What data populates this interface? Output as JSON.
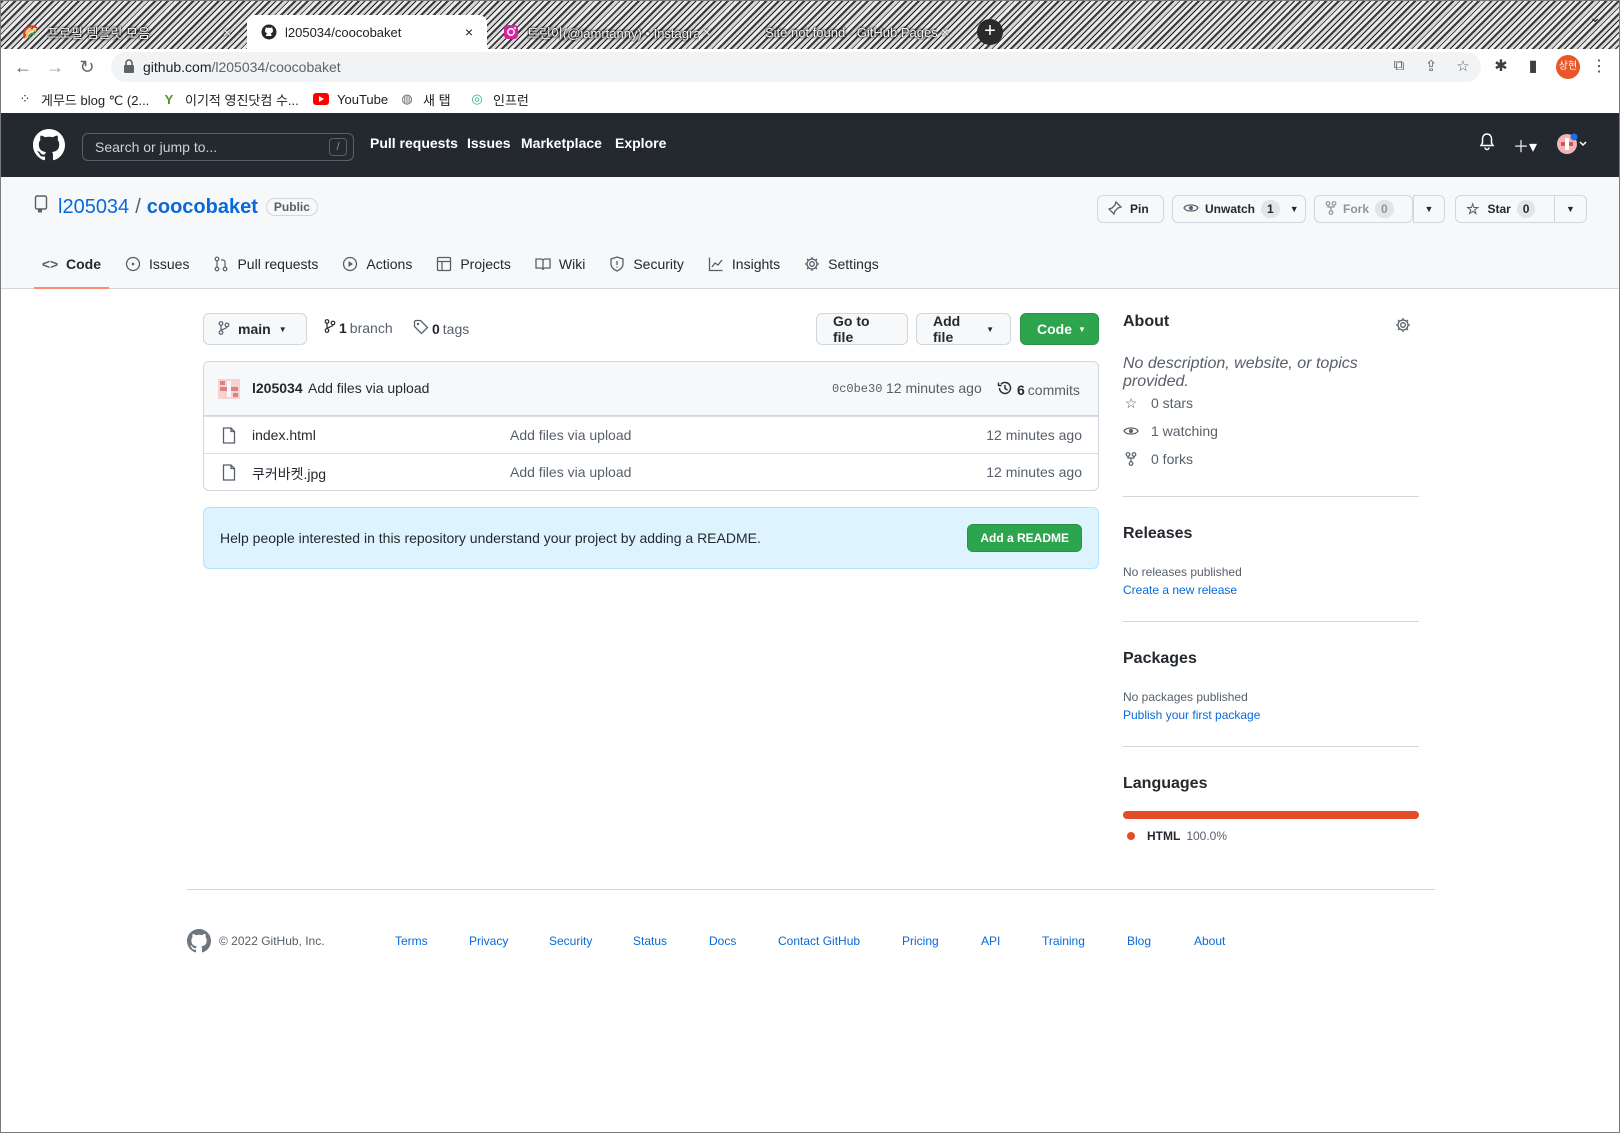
{
  "browser": {
    "tabs": [
      {
        "title": "프로필 템플릿 모음",
        "icon": "rainbow-icon"
      },
      {
        "title": "l205034/coocobaket",
        "icon": "github-icon"
      },
      {
        "title": "트린이(@iamrtanny) • Instagram",
        "icon": "instagram-icon"
      },
      {
        "title": "Site not found · GitHub Pages",
        "icon": "none"
      }
    ],
    "new_tab": "+",
    "url_host": "github.com",
    "url_path": "/l205034/coocobaket",
    "profile_label": "상현",
    "bookmarks": [
      {
        "label": "게무드 blog ℃ (2...",
        "icon": "dots-icon"
      },
      {
        "label": "이기적 영진닷컴 수...",
        "icon": "y-icon"
      },
      {
        "label": "YouTube",
        "icon": "youtube-icon"
      },
      {
        "label": "새 탭",
        "icon": "globe-icon"
      },
      {
        "label": "인프런",
        "icon": "inflearn-icon"
      }
    ]
  },
  "gh_header": {
    "search_placeholder": "Search or jump to...",
    "search_key": "/",
    "nav": [
      "Pull requests",
      "Issues",
      "Marketplace",
      "Explore"
    ]
  },
  "repo": {
    "owner": "l205034",
    "separator": "/",
    "name": "coocobaket",
    "visibility": "Public",
    "pin_label": "Pin",
    "watch_label": "Unwatch",
    "watch_count": "1",
    "fork_label": "Fork",
    "fork_count": "0",
    "star_label": "Star",
    "star_count": "0",
    "tabs": [
      {
        "label": "Code",
        "icon": "code-icon"
      },
      {
        "label": "Issues",
        "icon": "issue-icon"
      },
      {
        "label": "Pull requests",
        "icon": "pull-request-icon"
      },
      {
        "label": "Actions",
        "icon": "play-icon"
      },
      {
        "label": "Projects",
        "icon": "table-icon"
      },
      {
        "label": "Wiki",
        "icon": "book-icon"
      },
      {
        "label": "Security",
        "icon": "shield-icon"
      },
      {
        "label": "Insights",
        "icon": "graph-icon"
      },
      {
        "label": "Settings",
        "icon": "gear-icon"
      }
    ]
  },
  "main": {
    "branch": "main",
    "branch_count": "1",
    "branch_word": "branch",
    "tag_count": "0",
    "tag_word": "tags",
    "go_to_file": "Go to file",
    "add_file": "Add file",
    "code_btn": "Code",
    "commit": {
      "author": "l205034",
      "message": "Add files via upload",
      "sha": "0c0be30",
      "time": "12 minutes ago",
      "count": "6",
      "count_word": "commits"
    },
    "files": [
      {
        "name": "index.html",
        "message": "Add files via upload",
        "time": "12 minutes ago"
      },
      {
        "name": "쿠커바켓.jpg",
        "message": "Add files via upload",
        "time": "12 minutes ago"
      }
    ],
    "readme_text": "Help people interested in this repository understand your project by adding a README.",
    "readme_btn": "Add a README"
  },
  "sidebar": {
    "about_title": "About",
    "about_desc": "No description, website, or topics provided.",
    "stars": "0 stars",
    "watching": "1 watching",
    "forks": "0 forks",
    "releases_title": "Releases",
    "releases_none": "No releases published",
    "releases_link": "Create a new release",
    "packages_title": "Packages",
    "packages_none": "No packages published",
    "packages_link": "Publish your first package",
    "languages_title": "Languages",
    "lang_name": "HTML",
    "lang_pct": "100.0%",
    "lang_color": "#e34c26"
  },
  "footer": {
    "copyright": "© 2022 GitHub, Inc.",
    "links": [
      "Terms",
      "Privacy",
      "Security",
      "Status",
      "Docs",
      "Contact GitHub",
      "Pricing",
      "API",
      "Training",
      "Blog",
      "About"
    ]
  }
}
